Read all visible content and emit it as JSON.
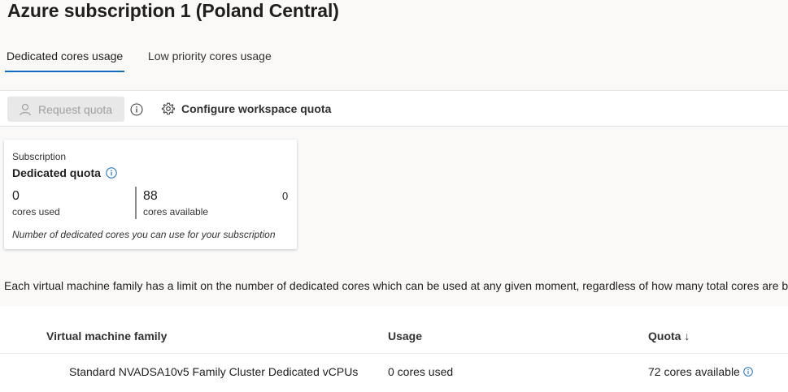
{
  "header": {
    "title": "Azure subscription 1 (Poland Central)"
  },
  "tabs": [
    {
      "label": "Dedicated cores usage",
      "active": true
    },
    {
      "label": "Low priority cores usage",
      "active": false
    }
  ],
  "toolbar": {
    "request_quota_label": "Request quota",
    "configure_label": "Configure workspace quota"
  },
  "card": {
    "subtitle": "Subscription",
    "title": "Dedicated quota",
    "used_value": "0",
    "used_label": "cores used",
    "available_value": "88",
    "available_label": "cores available",
    "extra_value": "0",
    "note": "Number of dedicated cores you can use for your subscription"
  },
  "description": "Each virtual machine family has a limit on the number of dedicated cores which can be used at any given moment, regardless of how many total cores are be",
  "table": {
    "columns": {
      "family": "Virtual machine family",
      "usage": "Usage",
      "quota": "Quota ↓"
    },
    "rows": [
      {
        "family": "Standard NVADSA10v5 Family Cluster Dedicated vCPUs",
        "usage": "0 cores used",
        "quota": "72 cores available"
      }
    ]
  },
  "colors": {
    "accent": "#0f6cbd",
    "disabled_bg": "#e8e8e8",
    "disabled_text": "#a19f9d"
  }
}
